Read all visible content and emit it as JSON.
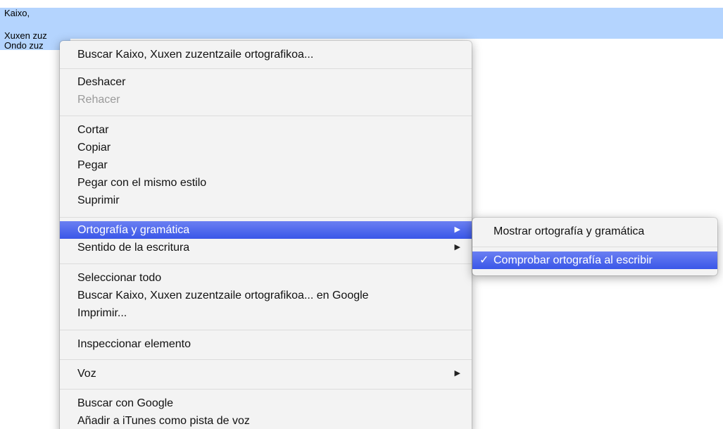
{
  "document": {
    "line1": "Kaixo,",
    "line2": "Xuxen zuz",
    "line3": "Ondo zuz"
  },
  "menu": {
    "items": [
      {
        "label": "Buscar Kaixo,  Xuxen zuzentzaile ortografikoa..."
      },
      {
        "label": "Deshacer"
      },
      {
        "label": "Rehacer"
      },
      {
        "label": "Cortar"
      },
      {
        "label": "Copiar"
      },
      {
        "label": "Pegar"
      },
      {
        "label": "Pegar con el mismo estilo"
      },
      {
        "label": "Suprimir"
      },
      {
        "label": "Ortografía y gramática"
      },
      {
        "label": "Sentido de la escritura"
      },
      {
        "label": "Seleccionar todo"
      },
      {
        "label": "Buscar Kaixo,  Xuxen zuzentzaile ortografikoa... en Google"
      },
      {
        "label": "Imprimir..."
      },
      {
        "label": "Inspeccionar elemento"
      },
      {
        "label": "Voz"
      },
      {
        "label": "Buscar con Google"
      },
      {
        "label": "Añadir a iTunes como pista de voz"
      }
    ],
    "submenu_arrow": "▶"
  },
  "submenu": {
    "items": [
      {
        "label": "Mostrar ortografía y gramática"
      },
      {
        "label": "Comprobar ortografía al escribir",
        "check": "✓"
      }
    ]
  },
  "colors": {
    "selection": "#b4d4fe",
    "highlight": "#3a57e8"
  }
}
